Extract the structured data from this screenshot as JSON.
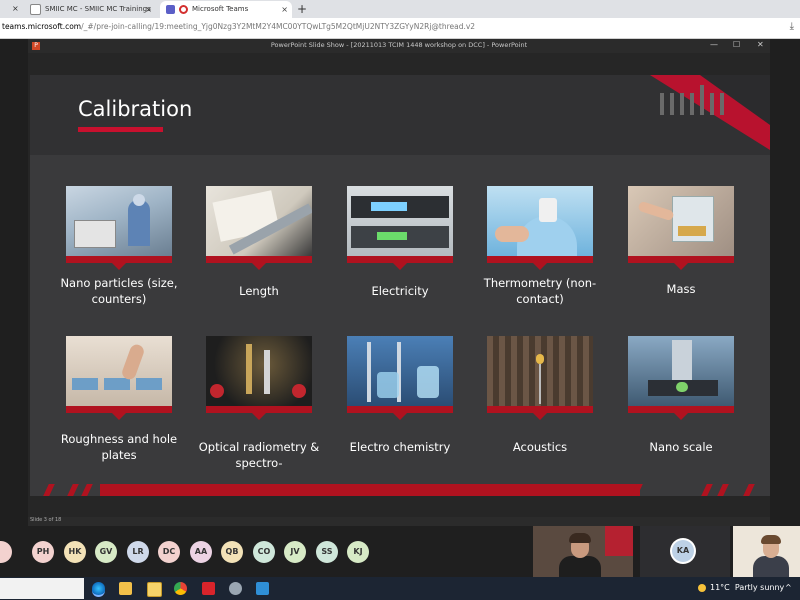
{
  "browser": {
    "tabs": [
      {
        "label": "SMIIC MC - SMIIC MC Trainings",
        "close": "×"
      },
      {
        "label": "Microsoft Teams",
        "close": "×"
      }
    ],
    "new_tab": "+",
    "left_close": "×",
    "url_host": "teams.microsoft.com",
    "url_path": "/_#/pre-join-calling/19:meeting_Yjg0Nzg3Y2MtM2Y4MC00YTQwLTg5M2QtMjU2NTY3ZGYyN2Rj@thread.v2"
  },
  "powerpoint": {
    "window_title": "PowerPoint Slide Show - [20211013 TCIM 1448 workshop on DCC] - PowerPoint",
    "controls": {
      "minimize": "—",
      "maximize": "☐",
      "close": "✕"
    },
    "status": "Slide 3 of 18"
  },
  "slide": {
    "title": "Calibration",
    "tiles_row1": [
      {
        "label": "Nano particles (size, counters)",
        "icon": "lab-equipment-image"
      },
      {
        "label": "Length",
        "icon": "measuring-ruler-image"
      },
      {
        "label": "Electricity",
        "icon": "electrical-meter-image"
      },
      {
        "label": "Thermometry (non-contact)",
        "icon": "thermometer-image"
      },
      {
        "label": "Mass",
        "icon": "balance-scale-image"
      }
    ],
    "tiles_row2": [
      {
        "label": "Roughness and hole plates",
        "icon": "roughness-gauge-image"
      },
      {
        "label": "Optical radiometry & spectro-",
        "icon": "optical-bench-image"
      },
      {
        "label": "Electro chemistry",
        "icon": "chemistry-apparatus-image"
      },
      {
        "label": "Acoustics",
        "icon": "anechoic-chamber-image"
      },
      {
        "label": "Nano scale",
        "icon": "microscope-image"
      }
    ]
  },
  "participants": [
    {
      "initials": "PH",
      "color": "#f3d2cf"
    },
    {
      "initials": "HK",
      "color": "#f3e2b7"
    },
    {
      "initials": "GV",
      "color": "#d7eac6"
    },
    {
      "initials": "LR",
      "color": "#cfd9ea"
    },
    {
      "initials": "DC",
      "color": "#f3d2cf"
    },
    {
      "initials": "AA",
      "color": "#ecd3e4"
    },
    {
      "initials": "QB",
      "color": "#f3e2b7"
    },
    {
      "initials": "CO",
      "color": "#cfe7da"
    },
    {
      "initials": "JV",
      "color": "#d7eac6"
    },
    {
      "initials": "SS",
      "color": "#cfe7da"
    },
    {
      "initials": "KJ",
      "color": "#d7eac6"
    }
  ],
  "video_tile_initials": "KA",
  "taskbar": {
    "weather_temp": "11°C",
    "weather_text": "Partly sunny",
    "tray_chevron": "^"
  }
}
